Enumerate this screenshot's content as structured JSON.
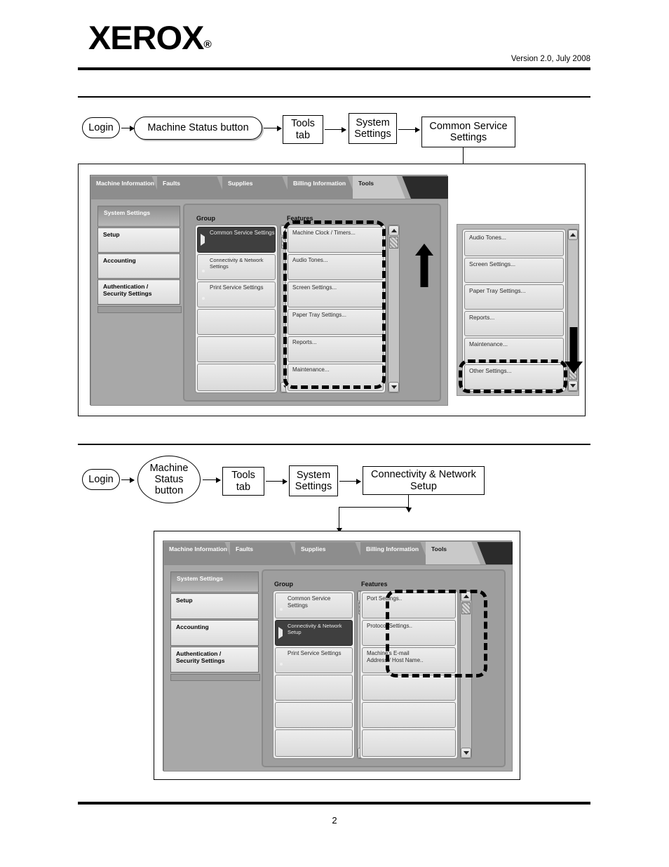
{
  "document": {
    "logo": "XEROX",
    "logo_registered": "®",
    "version": "Version 2.0, July 2008",
    "page_number": "2"
  },
  "flow1": {
    "nodes": [
      {
        "label": "Login",
        "shape": "round"
      },
      {
        "label": "Machine Status button",
        "shape": "round"
      },
      {
        "label": "Tools\ntab",
        "shape": "rect"
      },
      {
        "label": "System\nSettings",
        "shape": "rect"
      },
      {
        "label": "Common Service\nSettings",
        "shape": "rect"
      }
    ]
  },
  "flow2": {
    "nodes": [
      {
        "label": "Login",
        "shape": "round"
      },
      {
        "label": "Machine\nStatus\nbutton",
        "shape": "ellipse"
      },
      {
        "label": "Tools\ntab",
        "shape": "rect"
      },
      {
        "label": "System\nSettings",
        "shape": "rect"
      },
      {
        "label": "Connectivity & Network\nSetup",
        "shape": "rect"
      }
    ]
  },
  "screen1": {
    "tabs": [
      {
        "label": "Machine\nInformation",
        "selected": false
      },
      {
        "label": "Faults",
        "selected": false
      },
      {
        "label": "Supplies",
        "selected": false
      },
      {
        "label": "Billing\nInformation",
        "selected": false
      },
      {
        "label": "Tools",
        "selected": true
      }
    ],
    "nav_header": "System Settings",
    "nav_items": [
      "Setup",
      "Accounting",
      "Authentication /\nSecurity Settings"
    ],
    "group_label": "Group",
    "features_label": "Features",
    "group_items": [
      {
        "label": "Common Service Settings",
        "selected": true,
        "indicator": "triangle"
      },
      {
        "label": "Connectivity & Network Settings",
        "selected": false,
        "indicator": "dome"
      },
      {
        "label": "Print Service Settings",
        "selected": false,
        "indicator": "dome"
      },
      {
        "label": "",
        "selected": false,
        "indicator": "none"
      },
      {
        "label": "",
        "selected": false,
        "indicator": "none"
      },
      {
        "label": "",
        "selected": false,
        "indicator": "none"
      }
    ],
    "feature_items": [
      {
        "label": "Machine Clock / Timers..."
      },
      {
        "label": "Audio Tones..."
      },
      {
        "label": "Screen Settings..."
      },
      {
        "label": "Paper Tray Settings..."
      },
      {
        "label": "Reports..."
      },
      {
        "label": "Maintenance..."
      }
    ],
    "scrolled_feature_items": [
      {
        "label": "Audio Tones..."
      },
      {
        "label": "Screen Settings..."
      },
      {
        "label": "Paper Tray Settings..."
      },
      {
        "label": "Reports..."
      },
      {
        "label": "Maintenance..."
      },
      {
        "label": "Other Settings..."
      }
    ],
    "annotations": {
      "scroll_up_arrow": "scroll-up-annotation",
      "scroll_down_arrow": "scroll-down-annotation",
      "highlight_features": "dashed-highlight-features",
      "highlight_other_settings": "dashed-highlight-other-settings"
    }
  },
  "screen2": {
    "tabs": [
      {
        "label": "Machine\nInformation",
        "selected": false
      },
      {
        "label": "Faults",
        "selected": false
      },
      {
        "label": "Supplies",
        "selected": false
      },
      {
        "label": "Billing\nInformation",
        "selected": false
      },
      {
        "label": "Tools",
        "selected": true
      }
    ],
    "nav_header": "System Settings",
    "nav_items": [
      "Setup",
      "Accounting",
      "Authentication /\nSecurity Settings"
    ],
    "group_label": "Group",
    "features_label": "Features",
    "group_items": [
      {
        "label": "Common Service Settings",
        "selected": false,
        "indicator": "dome"
      },
      {
        "label": "Connectivity & Network Setup",
        "selected": true,
        "indicator": "triangle"
      },
      {
        "label": "Print Service Settings",
        "selected": false,
        "indicator": "dome"
      },
      {
        "label": "",
        "selected": false,
        "indicator": "none"
      },
      {
        "label": "",
        "selected": false,
        "indicator": "none"
      },
      {
        "label": "",
        "selected": false,
        "indicator": "none"
      }
    ],
    "feature_items": [
      {
        "label": "Port Settings.."
      },
      {
        "label": "Protocol Settings.."
      },
      {
        "label": "Machine's E-mail\nAddress / Host Name.."
      },
      {
        "label": ""
      },
      {
        "label": ""
      },
      {
        "label": ""
      }
    ],
    "annotations": {
      "highlight_features": "dashed-highlight-network-features"
    }
  }
}
